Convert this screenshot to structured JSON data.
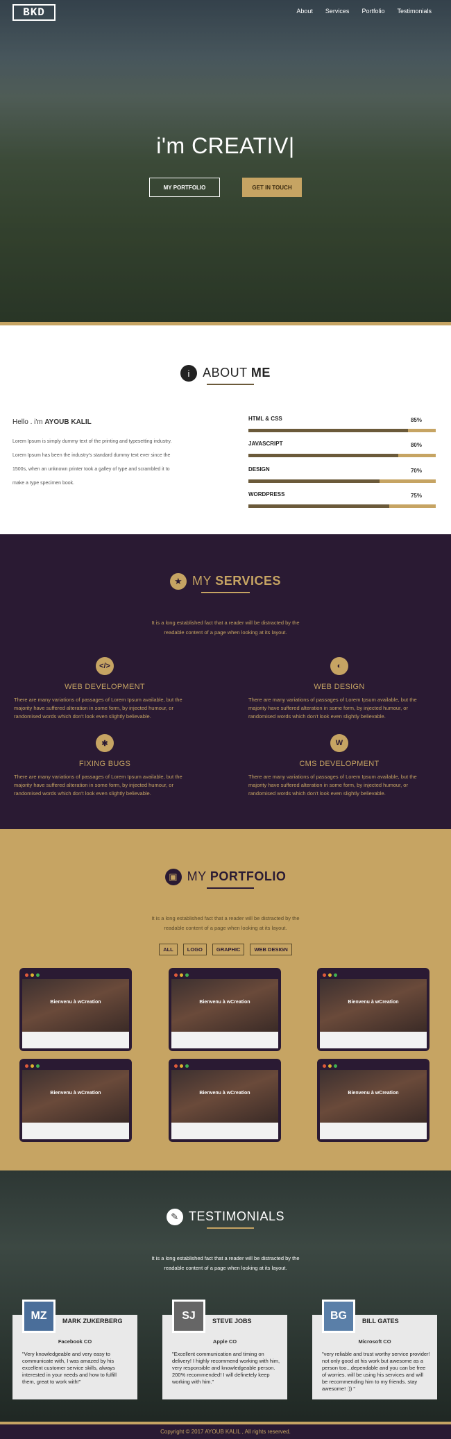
{
  "header": {
    "logo_text": "BKD",
    "nav": [
      "About",
      "Services",
      "Portfolio",
      "Testimonials"
    ]
  },
  "hero": {
    "title_prefix": "i'm",
    "title_word": "CREATIV",
    "btn_portfolio": "MY PORTFOLIO",
    "btn_contact": "GET IN TOUCH"
  },
  "about": {
    "title_light": "ABOUT",
    "title_bold": "ME",
    "hello": "Hello . i'm",
    "name": "AYOUB KALIL",
    "p1": "Lorem Ipsum is simply dummy text of the printing and typesetting industry.",
    "p2": "Lorem Ipsum has been the industry's standard dummy text ever since the",
    "p3": "1500s, when an unknown printer took a galley of type and scrambled it to",
    "p4": "make a type specimen book.",
    "skills": [
      {
        "name": "HTML & CSS",
        "pct": "85%",
        "value": 85
      },
      {
        "name": "JAVASCRIPT",
        "pct": "80%",
        "value": 80
      },
      {
        "name": "DESIGN",
        "pct": "70%",
        "value": 70
      },
      {
        "name": "WORDPRESS",
        "pct": "75%",
        "value": 75
      }
    ]
  },
  "services": {
    "title_light": "MY",
    "title_bold": "SERVICES",
    "lead1": "It is a long established fact that a reader will be distracted by the",
    "lead2": "readable content of a page when looking at its layout.",
    "items": [
      {
        "title": "WEB DEVELOPMENT",
        "desc": "There are many variations of passages of Lorem Ipsum available, but the majority have suffered alteration in some form, by injected humour, or randomised words which don't look even slightly believable."
      },
      {
        "title": "WEB DESIGN",
        "desc": "There are many variations of passages of Lorem Ipsum available, but the majority have suffered alteration in some form, by injected humour, or randomised words which don't look even slightly believable."
      },
      {
        "title": "FIXING BUGS",
        "desc": "There are many variations of passages of Lorem Ipsum available, but the majority have suffered alteration in some form, by injected humour, or randomised words which don't look even slightly believable."
      },
      {
        "title": "CMS DEVELOPMENT",
        "desc": "There are many variations of passages of Lorem Ipsum available, but the majority have suffered alteration in some form, by injected humour, or randomised words which don't look even slightly believable."
      }
    ]
  },
  "portfolio": {
    "title_light": "MY",
    "title_bold": "PORTFOLIO",
    "lead1": "It is a long established fact that a reader will be distracted by the",
    "lead2": "readable content of a page when looking at its layout.",
    "filters": [
      "ALL",
      "LOGO",
      "GRAPHIC",
      "WEB DESIGN"
    ],
    "card_caption": "Bienvenu à wCreation"
  },
  "testimonials": {
    "title": "TESTIMONIALS",
    "lead1": "It is a long established fact that a reader will be distracted by the",
    "lead2": "readable content of a page when looking at its layout.",
    "items": [
      {
        "name": "MARK ZUKERBERG",
        "company": "Facebook CO",
        "quote": "\"Very knowledgeable and very easy to communicate with, I was amazed by his excellent customer service skills, always interested in your needs and how to fulfill them, great to work with!\""
      },
      {
        "name": "STEVE JOBS",
        "company": "Apple CO",
        "quote": "\"Excellent communication and timing on delivery! I highly recommend working with him, very responsible and knowledgeable person. 200% recommended! I will definetely keep working with him.\""
      },
      {
        "name": "BILL GATES",
        "company": "Microsoft CO",
        "quote": "\"very reliable and trust worthy service provider! not only good at his work but awesome as a person too...dependable and you can be free of worries. will be using his services and will be recommending him to my friends. stay awesome! :)) \""
      }
    ]
  },
  "footer": {
    "text": "Copyright © 2017 AYOUB KALIL , All rights reserved."
  },
  "colors": {
    "gold": "#c6a463",
    "purple": "#2a1a33"
  }
}
